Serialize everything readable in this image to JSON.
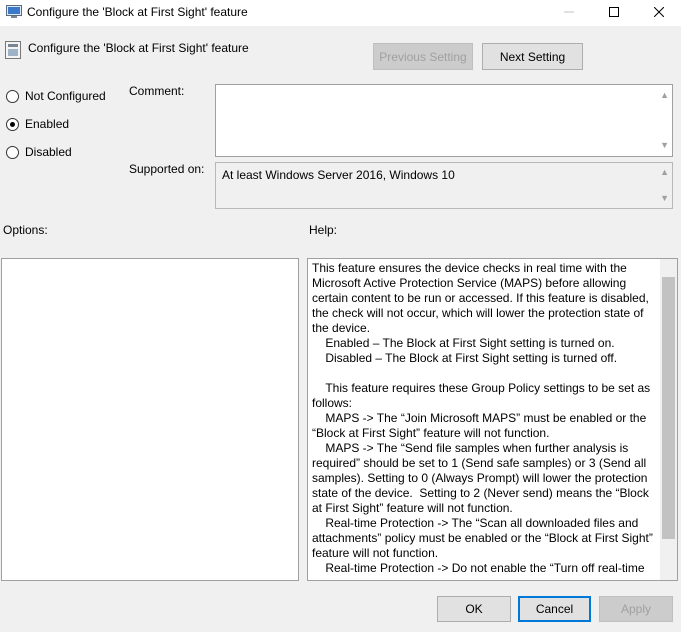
{
  "window": {
    "title": "Configure the 'Block at First Sight' feature",
    "controls": {
      "minimize": "—",
      "maximize": "☐",
      "close": "✕"
    }
  },
  "header": {
    "title": "Configure the 'Block at First Sight' feature",
    "previous_setting": "Previous Setting",
    "next_setting": "Next Setting"
  },
  "state": {
    "options": [
      {
        "label": "Not Configured",
        "checked": false
      },
      {
        "label": "Enabled",
        "checked": true
      },
      {
        "label": "Disabled",
        "checked": false
      }
    ]
  },
  "comment": {
    "label": "Comment:",
    "value": ""
  },
  "supported": {
    "label": "Supported on:",
    "value": "At least Windows Server 2016, Windows 10"
  },
  "options_label": "Options:",
  "help_label": "Help:",
  "help_text": "This feature ensures the device checks in real time with the Microsoft Active Protection Service (MAPS) before allowing certain content to be run or accessed. If this feature is disabled, the check will not occur, which will lower the protection state of the device.\n    Enabled – The Block at First Sight setting is turned on.\n    Disabled – The Block at First Sight setting is turned off.\n\n    This feature requires these Group Policy settings to be set as follows:\n    MAPS -> The “Join Microsoft MAPS” must be enabled or the “Block at First Sight” feature will not function.\n    MAPS -> The “Send file samples when further analysis is required” should be set to 1 (Send safe samples) or 3 (Send all samples). Setting to 0 (Always Prompt) will lower the protection state of the device.  Setting to 2 (Never send) means the “Block at First Sight” feature will not function.\n    Real-time Protection -> The “Scan all downloaded files and attachments” policy must be enabled or the “Block at First Sight” feature will not function.\n    Real-time Protection -> Do not enable the “Turn off real-time protection” policy or the “Block at First Sight” feature will not function.",
  "footer": {
    "ok": "OK",
    "cancel": "Cancel",
    "apply": "Apply"
  }
}
